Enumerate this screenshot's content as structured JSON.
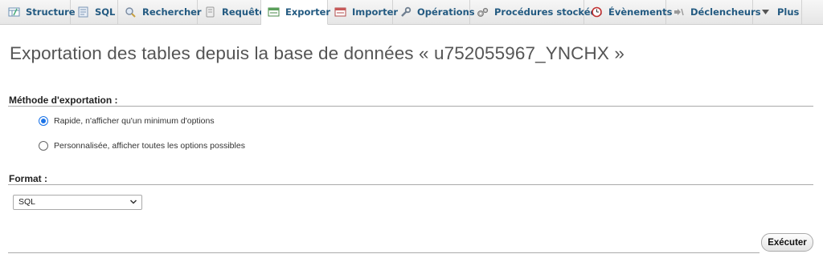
{
  "tabs": [
    {
      "label": "Structure",
      "icon": "structure-icon"
    },
    {
      "label": "SQL",
      "icon": "sql-icon"
    },
    {
      "label": "Rechercher",
      "icon": "search-icon"
    },
    {
      "label": "Requête",
      "icon": "query-icon"
    },
    {
      "label": "Exporter",
      "icon": "export-icon",
      "active": true
    },
    {
      "label": "Importer",
      "icon": "import-icon"
    },
    {
      "label": "Opérations",
      "icon": "wrench-icon"
    },
    {
      "label": "Procédures stockées",
      "icon": "gears-icon"
    },
    {
      "label": "Évènements",
      "icon": "clock-icon"
    },
    {
      "label": "Déclencheurs",
      "icon": "trigger-icon"
    },
    {
      "label": "Plus",
      "icon": "caret-down-icon"
    }
  ],
  "main": {
    "title": "Exportation des tables depuis la base de données « u752055967_YNCHX »",
    "method": {
      "heading": "Méthode d'exportation :",
      "options": [
        {
          "label": "Rapide, n'afficher qu'un minimum d'options",
          "checked": true
        },
        {
          "label": "Personnalisée, afficher toutes les options possibles",
          "checked": false
        }
      ]
    },
    "format": {
      "heading": "Format :",
      "selected": "SQL"
    },
    "execute_label": "Exécuter"
  },
  "colors": {
    "tab_text": "#235a81",
    "radio_accent": "#1a73e8"
  }
}
